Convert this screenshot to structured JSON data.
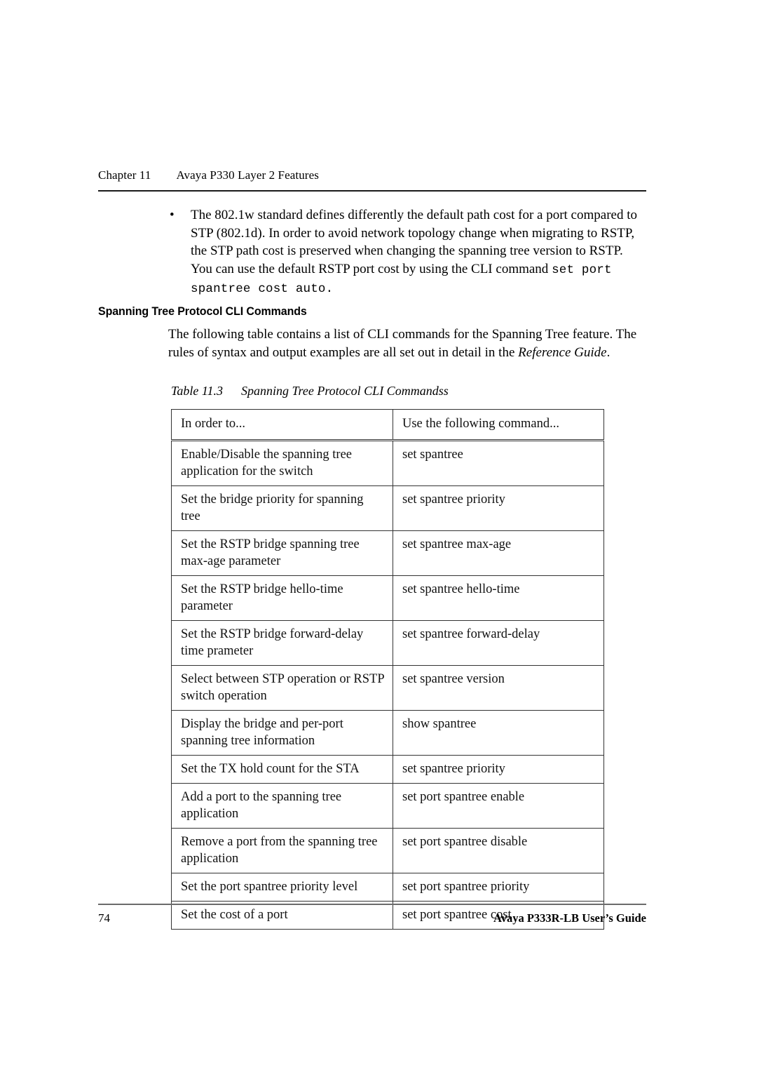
{
  "header": {
    "chapter": "Chapter 11",
    "title": "Avaya P330 Layer 2 Features"
  },
  "bullet": {
    "marker": "•",
    "text_before_code": "The 802.1w standard defines differently the default path cost for a port compared to STP (802.1d). In order to avoid network topology change when migrating to RSTP, the STP path cost is preserved when changing the spanning tree version to RSTP. You can use the default RSTP port cost by using the CLI command",
    "code": "set port spantree cost auto."
  },
  "section": {
    "heading": "Spanning Tree Protocol CLI Commands",
    "intro_part1": "The following table contains a list of CLI commands for the Spanning Tree feature. The  rules of syntax and output examples are all set out in detail in the ",
    "intro_italic": "Reference Guide",
    "intro_part2": "."
  },
  "table": {
    "caption_number": "Table 11.3",
    "caption_text": "Spanning Tree Protocol CLI Commandss",
    "columns": [
      "In order to...",
      "Use the following command..."
    ],
    "rows": [
      {
        "task": "Enable/Disable the spanning tree application for the switch",
        "command": "set spantree",
        "lines": 2
      },
      {
        "task": "Set the bridge priority for spanning tree",
        "command": "set spantree priority",
        "lines": 2
      },
      {
        "task": "Set the RSTP bridge spanning tree max-age parameter",
        "command": "set spantree max-age",
        "lines": 2
      },
      {
        "task": "Set the RSTP bridge hello-time parameter",
        "command": "set spantree hello-time",
        "lines": 2
      },
      {
        "task": "Set the RSTP bridge forward-delay time prameter",
        "command": "set spantree forward-delay",
        "lines": 2
      },
      {
        "task": "Select between STP operation or RSTP switch operation",
        "command": "set spantree version",
        "lines": 2
      },
      {
        "task": "Display the bridge and per-port spanning tree information",
        "command": "show spantree",
        "lines": 2
      },
      {
        "task": "Set the TX hold count for the STA",
        "command": "set spantree priority",
        "lines": 1
      },
      {
        "task": "Add a port to the spanning tree application",
        "command": "set port spantree enable",
        "lines": 2
      },
      {
        "task": "Remove a port from the spanning tree application",
        "command": "set port spantree disable",
        "lines": 2
      },
      {
        "task": "Set the port spantree priority level",
        "command": "set port spantree priority",
        "lines": 1
      },
      {
        "task": "Set the cost of a port",
        "command": "set port spantree cost",
        "lines": 1
      }
    ]
  },
  "footer": {
    "page_number": "74",
    "guide_title": "Avaya P333R-LB User’s Guide"
  }
}
